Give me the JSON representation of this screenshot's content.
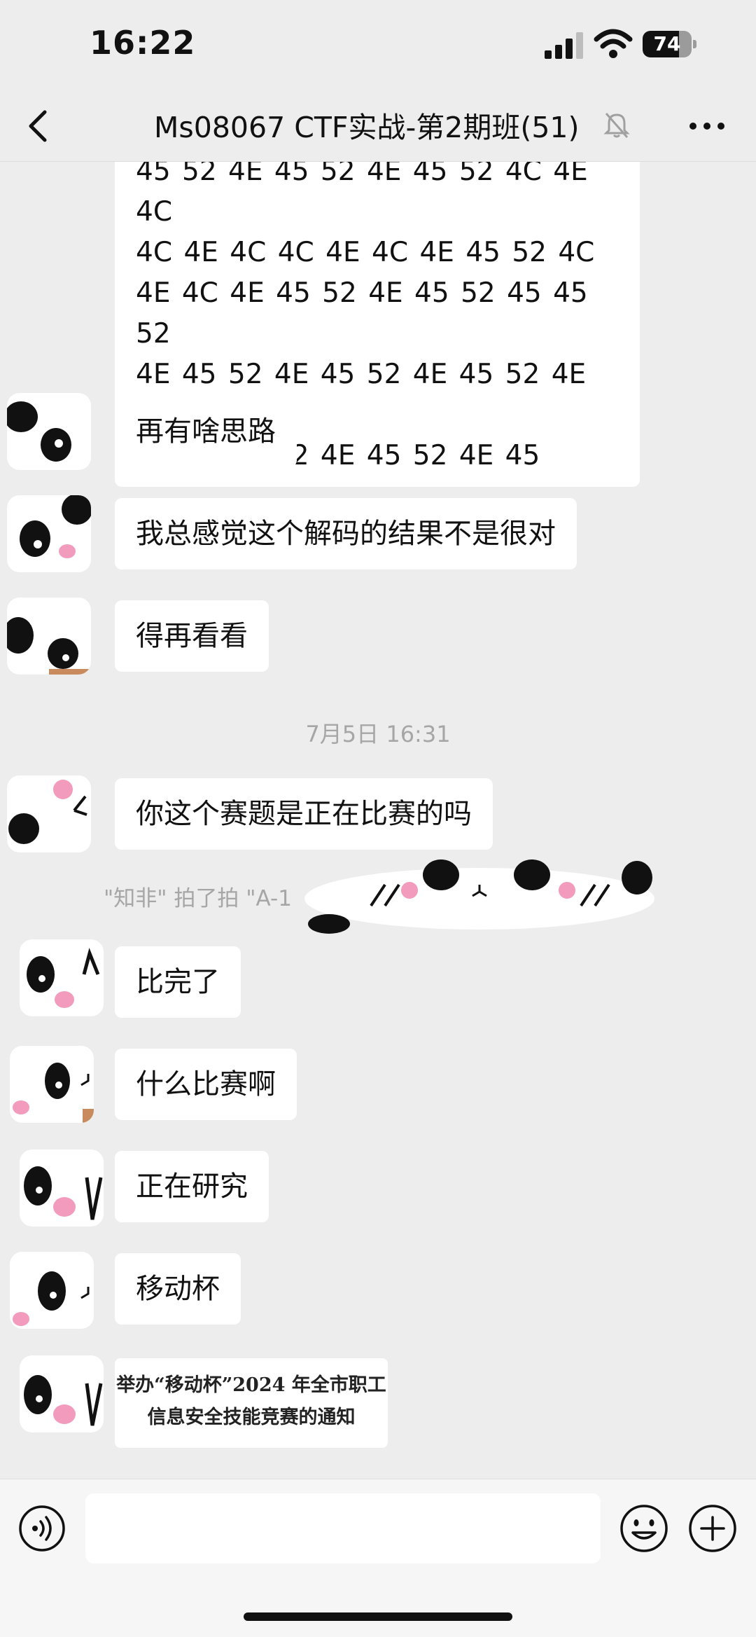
{
  "status_bar": {
    "time": "16:22",
    "battery": "74",
    "battery_level": 0.74
  },
  "nav": {
    "title": "Ms08067 CTF实战-第2期班(51)"
  },
  "messages": {
    "hex_lines": [
      "45 52 4E 45 52 4E 45 52 4C 4E 4C",
      "4C 4E 4C 4C 4E 4C 4E 45 52 4C",
      "4E 4C 4E 45 52 4E 45 52 45 45 52",
      "4E 45 52 4E 45 52 4E 45 52 4E 45",
      "52 4E 45 52 4E 45 52 4E 45"
    ],
    "m1": "再有啥思路",
    "m2": "我总感觉这个解码的结果不是很对",
    "m3": "得再看看",
    "timestamp": "7月5日 16:31",
    "m4": "你这个赛题是正在比赛的吗",
    "system_notice": "\"知非\" 拍了拍 \"A-1",
    "m5": "比完了",
    "m6": "什么比赛啊",
    "m7": "正在研究",
    "m8": "移动杯",
    "card_line1": "举办“移动杯”2024 年全市职工",
    "card_line2": "信息安全技能竞赛的通知"
  },
  "icons": {
    "back": "chevron-left-icon",
    "mute": "bell-off-icon",
    "more": "more-dots-icon",
    "voice": "voice-icon",
    "emoji": "emoji-icon",
    "plus": "plus-icon"
  },
  "colors": {
    "background": "#ededed",
    "bubble": "#ffffff",
    "muted_text": "#a6a6a6",
    "panda_pink": "#f29bbd"
  }
}
